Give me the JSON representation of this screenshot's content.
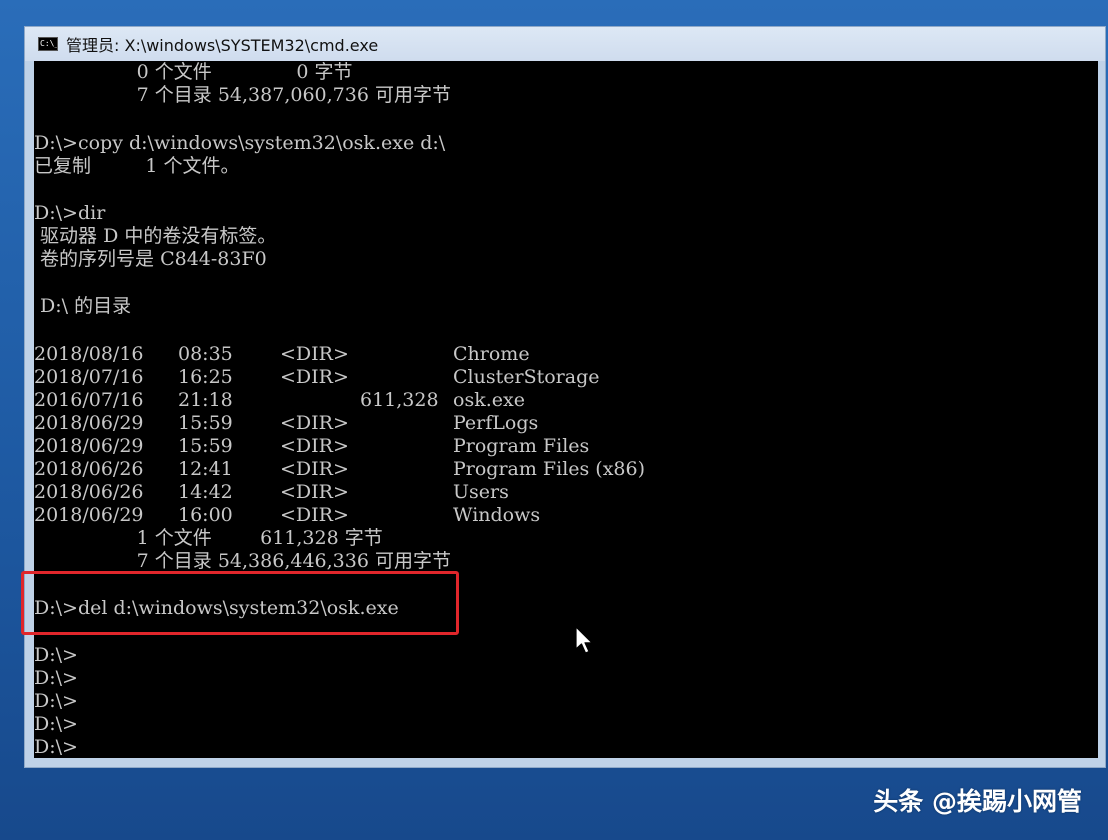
{
  "window": {
    "title": "管理员: X:\\windows\\SYSTEM32\\cmd.exe",
    "icon": "cmd-icon",
    "icon_label": "C:\\_"
  },
  "console": {
    "prev_summary_files": "                 0 个文件              0 字节",
    "prev_summary_dirs": "                 7 个目录 54,387,060,736 可用字节",
    "copy_cmd": "D:\\>copy d:\\windows\\system32\\osk.exe d:\\",
    "copy_result": "已复制         1 个文件。",
    "dir_cmd": "D:\\>dir",
    "volume_label": " 驱动器 D 中的卷没有标签。",
    "volume_serial": " 卷的序列号是 C844-83F0",
    "dir_heading": " D:\\ 的目录",
    "listing": [
      {
        "date": "2018/08/16",
        "time": "08:35",
        "type": "<DIR>",
        "size": "",
        "name": "Chrome"
      },
      {
        "date": "2018/07/16",
        "time": "16:25",
        "type": "<DIR>",
        "size": "",
        "name": "ClusterStorage"
      },
      {
        "date": "2016/07/16",
        "time": "21:18",
        "type": "",
        "size": "611,328",
        "name": "osk.exe"
      },
      {
        "date": "2018/06/29",
        "time": "15:59",
        "type": "<DIR>",
        "size": "",
        "name": "PerfLogs"
      },
      {
        "date": "2018/06/29",
        "time": "15:59",
        "type": "<DIR>",
        "size": "",
        "name": "Program Files"
      },
      {
        "date": "2018/06/26",
        "time": "12:41",
        "type": "<DIR>",
        "size": "",
        "name": "Program Files (x86)"
      },
      {
        "date": "2018/06/26",
        "time": "14:42",
        "type": "<DIR>",
        "size": "",
        "name": "Users"
      },
      {
        "date": "2018/06/29",
        "time": "16:00",
        "type": "<DIR>",
        "size": "",
        "name": "Windows"
      }
    ],
    "summary_files": "                 1 个文件        611,328 字节",
    "summary_dirs": "                 7 个目录 54,386,446,336 可用字节",
    "del_cmd": "D:\\>del d:\\windows\\system32\\osk.exe",
    "prompts": [
      "D:\\>",
      "D:\\>",
      "D:\\>",
      "D:\\>",
      "D:\\>"
    ]
  },
  "annotation": {
    "highlight_color": "#e0262b"
  },
  "watermark": {
    "text": "头条 @挨踢小网管"
  },
  "colors": {
    "desktop": "#1f5fa8",
    "console_bg": "#000000",
    "console_text": "#c8c8c8",
    "titlebar": "#d6e2f1"
  }
}
